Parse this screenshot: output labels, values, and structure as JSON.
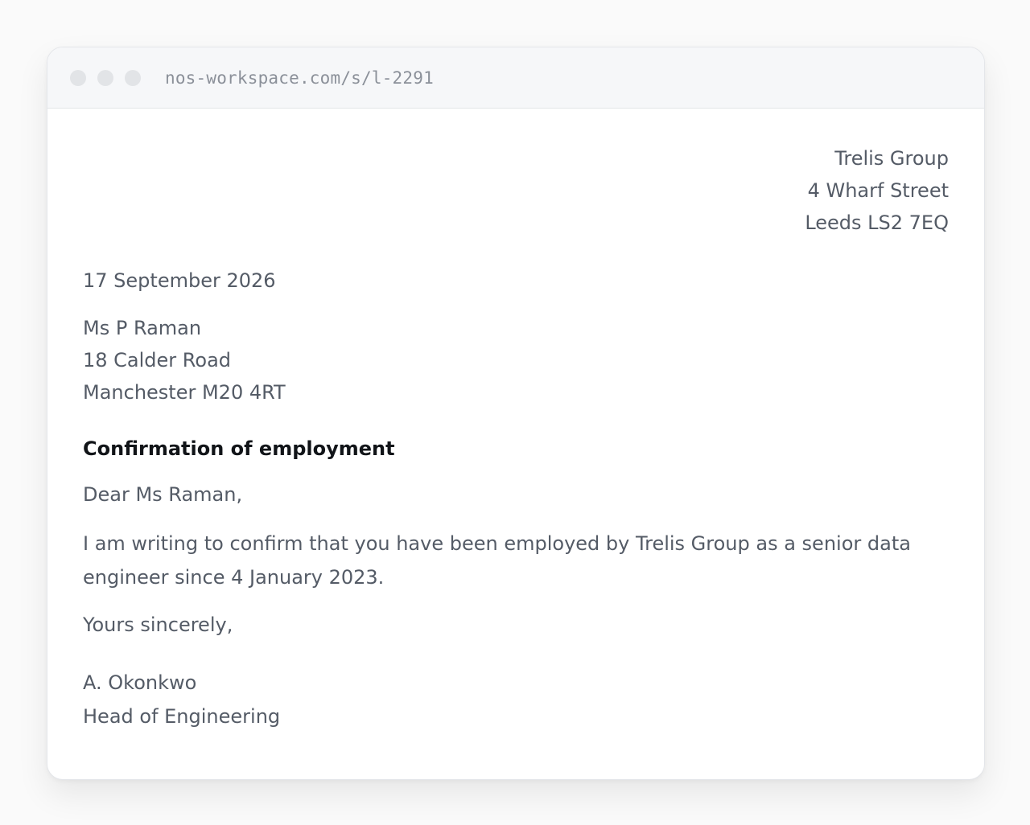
{
  "browser": {
    "url": "nos-workspace.com/s/l-2291"
  },
  "letter": {
    "sender": {
      "name": "Trelis Group",
      "street": "4 Wharf Street",
      "city": "Leeds LS2 7EQ"
    },
    "date": "17 September 2026",
    "recipient": {
      "name": "Ms P Raman",
      "street": "18 Calder Road",
      "city": "Manchester M20 4RT"
    },
    "subject": "Confirmation of employment",
    "greeting": "Dear Ms Raman,",
    "body": "I am writing to confirm that you have been employed by Trelis Group as a senior data engineer since 4 January 2023.",
    "closing": "Yours sincerely,",
    "signatory": {
      "name": "A. Okonkwo",
      "title": "Head of Engineering"
    }
  }
}
